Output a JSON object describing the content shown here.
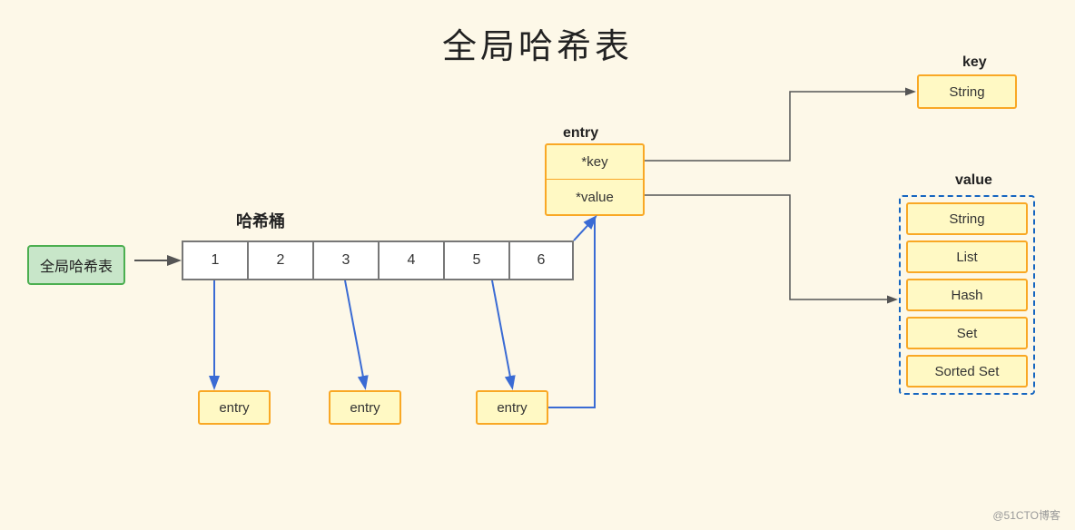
{
  "title": "全局哈希表",
  "global_ht_label": "全局哈希表",
  "bucket_label": "哈希桶",
  "bucket_cells": [
    "1",
    "2",
    "3",
    "4",
    "5",
    "6"
  ],
  "entry_label": "entry",
  "entry_upper": {
    "row1": "*key",
    "row2": "*value"
  },
  "entry_boxes": [
    "entry",
    "entry",
    "entry"
  ],
  "key_section": {
    "label": "key",
    "box": "String"
  },
  "value_section": {
    "label": "value",
    "items": [
      "String",
      "List",
      "Hash",
      "Set",
      "Sorted Set"
    ]
  },
  "watermark": "@51CTO博客",
  "colors": {
    "background": "#fdf8e8",
    "green_box_bg": "#c8e6c9",
    "green_box_border": "#4caf50",
    "yellow_box_bg": "#fff9c4",
    "yellow_box_border": "#f9a825",
    "arrow_color": "#3a6bd4",
    "dashed_border": "#1565c0"
  }
}
